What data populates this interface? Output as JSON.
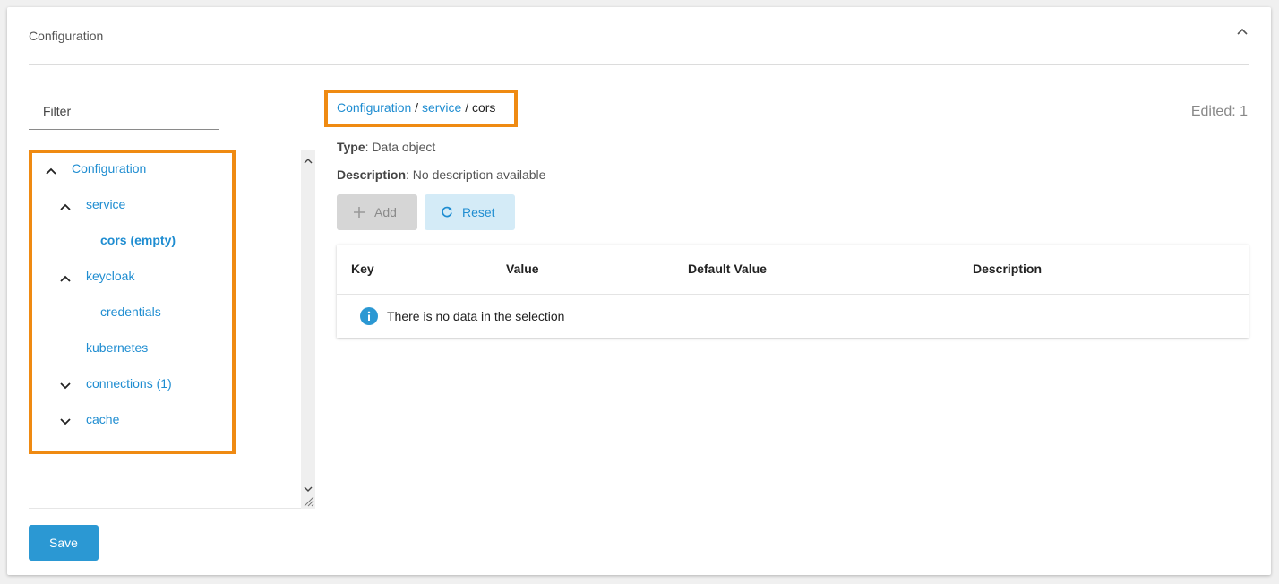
{
  "header": {
    "title": "Configuration"
  },
  "filter": {
    "placeholder": "Filter"
  },
  "tree": {
    "items": [
      {
        "label": "Configuration",
        "expanded": true
      },
      {
        "label": "service",
        "expanded": true
      },
      {
        "label": "cors (empty)",
        "selected": true
      },
      {
        "label": "keycloak",
        "expanded": true
      },
      {
        "label": "credentials"
      },
      {
        "label": "kubernetes"
      },
      {
        "label": "connections (1)",
        "expanded": false
      },
      {
        "label": "cache",
        "expanded": false
      }
    ]
  },
  "breadcrumb": {
    "root": "Configuration",
    "sep1": " / ",
    "parent": "service",
    "sep2": " / ",
    "current": "cors"
  },
  "edited": "Edited: 1",
  "details": {
    "type_label": "Type",
    "type_value": ": Data object",
    "description_label": "Description",
    "description_value": ": No description available"
  },
  "actions": {
    "add_label": "Add",
    "reset_label": "Reset",
    "save_label": "Save"
  },
  "table": {
    "columns": [
      "Key",
      "Value",
      "Default Value",
      "Description"
    ],
    "empty_message": "There is no data in the selection"
  },
  "colors": {
    "accent": "#1f8dd1",
    "primary_button": "#2b98d3",
    "highlight": "#ef8a12"
  }
}
